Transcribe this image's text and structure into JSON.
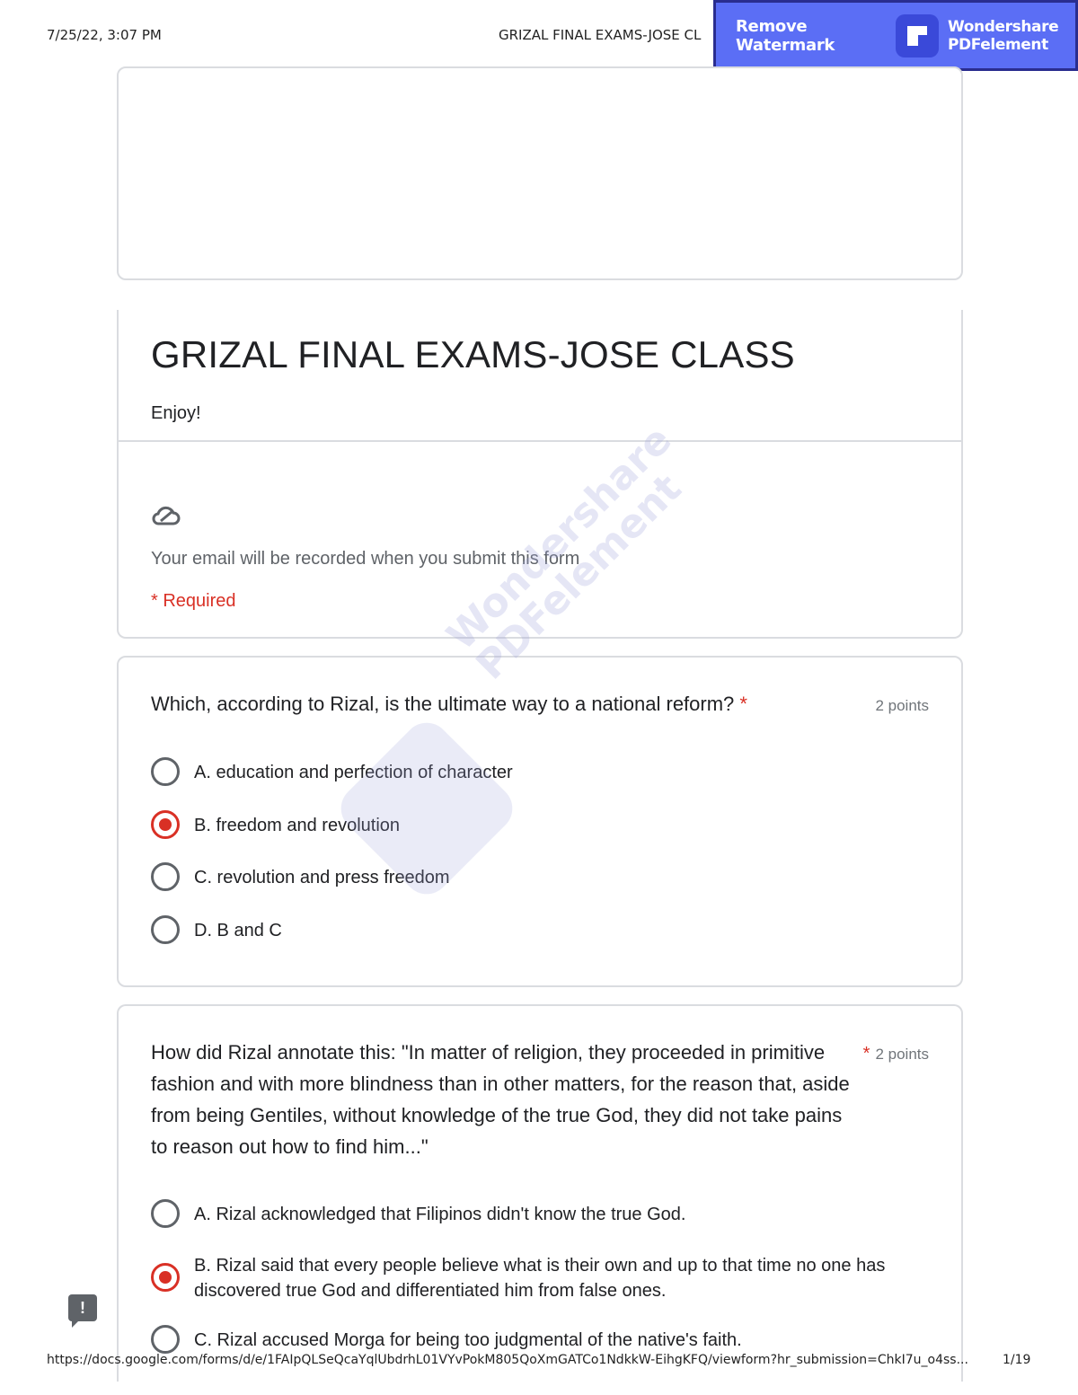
{
  "print_header": {
    "datetime": "7/25/22, 3:07 PM",
    "title": "GRIZAL FINAL EXAMS-JOSE CL"
  },
  "watermark": {
    "remove_label": "Remove Watermark",
    "brand_line1": "Wondershare",
    "brand_line2": "PDFelement"
  },
  "form": {
    "title": "GRIZAL FINAL EXAMS-JOSE CLASS",
    "description": "Enjoy!",
    "icon": "cloud-sync-icon",
    "email_note": "Your email will be recorded when you submit this form",
    "required_note": "* Required"
  },
  "questions": [
    {
      "text": "Which, according to Rizal, is the ultimate way to a national reform?",
      "required_mark": "*",
      "points": "2 points",
      "options": [
        {
          "label": "A. education and perfection of character",
          "selected": false
        },
        {
          "label": "B. freedom and revolution",
          "selected": true
        },
        {
          "label": "C. revolution and press freedom",
          "selected": false
        },
        {
          "label": "D. B and C",
          "selected": false
        }
      ]
    },
    {
      "text": "How did Rizal annotate this: \"In matter of religion, they proceeded in primitive fashion and with more blindness than in other matters, for the reason that, aside from being Gentiles, without knowledge of the true God, they did not take pains to reason out how to find him...\"",
      "required_mark": "*",
      "points": "2 points",
      "options": [
        {
          "label": "A. Rizal acknowledged that Filipinos didn't know the true God.",
          "selected": false
        },
        {
          "label": "B. Rizal said that every people believe what is their own and up to that time no one has discovered true God and differentiated him from false ones.",
          "selected": true
        },
        {
          "label": "C. Rizal accused Morga for being too judgmental of the native's faith.",
          "selected": false
        }
      ]
    }
  ],
  "print_footer": {
    "url": "https://docs.google.com/forms/d/e/1FAIpQLSeQcaYqlUbdrhL01VYvPokM805QoXmGATCo1NdkkW-EihgKFQ/viewform?hr_submission=ChkI7u_o4ss...",
    "page": "1/19"
  },
  "colors": {
    "required_red": "#d93025",
    "watermark_blue": "#5b6ef5"
  }
}
